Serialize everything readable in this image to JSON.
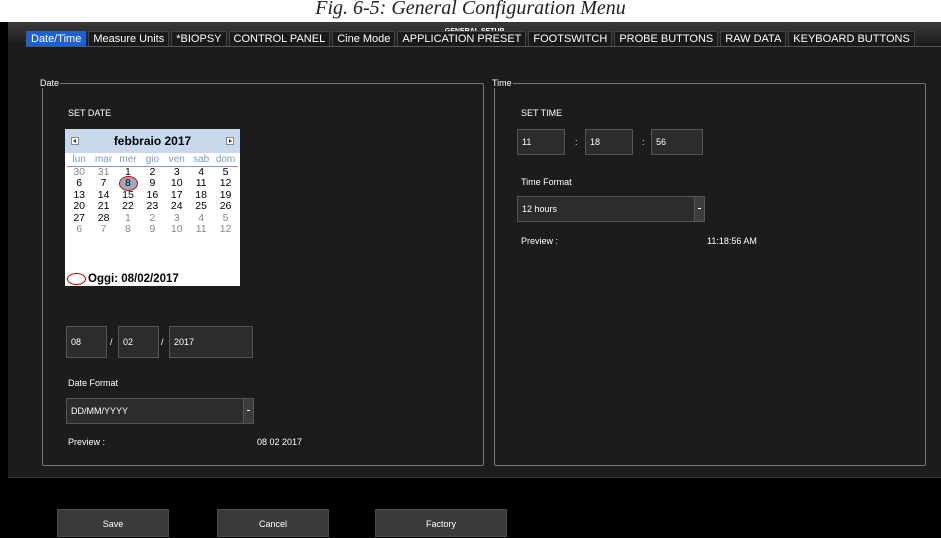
{
  "caption": "Fig. 6-5: General Configuration Menu",
  "window": {
    "title": "GENERAL SETUP"
  },
  "tabs": [
    {
      "label": "Date/Time",
      "active": true
    },
    {
      "label": "Measure Units"
    },
    {
      "label": "*BIOPSY"
    },
    {
      "label": "CONTROL PANEL"
    },
    {
      "label": "Cine Mode"
    },
    {
      "label": "APPLICATION PRESET"
    },
    {
      "label": "FOOTSWITCH"
    },
    {
      "label": "PROBE BUTTONS"
    },
    {
      "label": "RAW DATA"
    },
    {
      "label": "KEYBOARD BUTTONS"
    }
  ],
  "date": {
    "legend": "Date",
    "set_label": "SET DATE",
    "calendar": {
      "month_label": "febbraio 2017",
      "weekdays": [
        "lun",
        "mar",
        "mer",
        "gio",
        "ven",
        "sab",
        "dom"
      ],
      "days": [
        [
          "30",
          "31",
          "1",
          "2",
          "3",
          "4",
          "5"
        ],
        [
          "6",
          "7",
          "8",
          "9",
          "10",
          "11",
          "12"
        ],
        [
          "13",
          "14",
          "15",
          "16",
          "17",
          "18",
          "19"
        ],
        [
          "20",
          "21",
          "22",
          "23",
          "24",
          "25",
          "26"
        ],
        [
          "27",
          "28",
          "1",
          "2",
          "3",
          "4",
          "5"
        ],
        [
          "6",
          "7",
          "8",
          "9",
          "10",
          "11",
          "12"
        ]
      ],
      "selected_day": "8",
      "today_label": "Oggi: 08/02/2017"
    },
    "day": "08",
    "month": "02",
    "year": "2017",
    "separator": "/",
    "format_label": "Date Format",
    "format_value": "DD/MM/YYYY",
    "preview_label": "Preview :",
    "preview_value": "08 02 2017"
  },
  "time": {
    "legend": "Time",
    "set_label": "SET TIME",
    "hour": "11",
    "minute": "18",
    "second": "56",
    "separator": ":",
    "format_label": "Time Format",
    "format_value": "12 hours",
    "preview_label": "Preview :",
    "preview_value": "11:18:56 AM"
  },
  "buttons": {
    "save": "Save",
    "cancel": "Cancel",
    "factory": "Factory"
  },
  "colors": {
    "active_tab": "#1f5fd1",
    "calendar_header": "#c8d9ee",
    "selection_ring": "#cc0000"
  }
}
